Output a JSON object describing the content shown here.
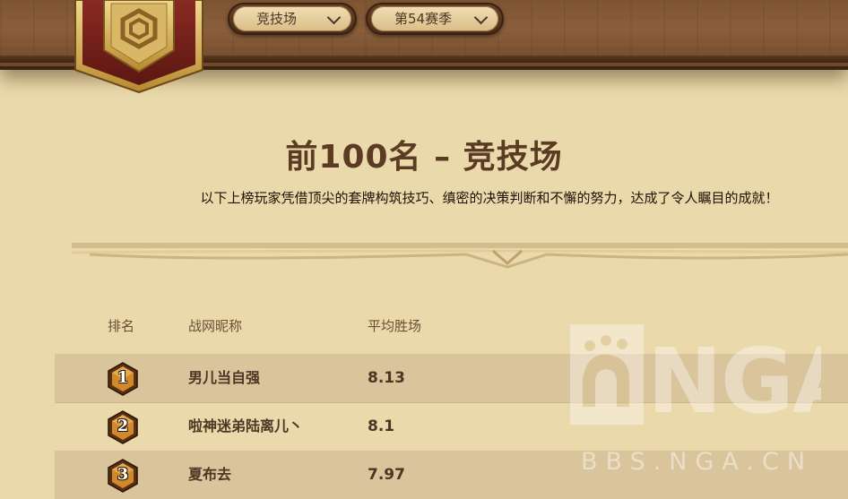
{
  "header": {
    "mode_select": {
      "value": "竞技场"
    },
    "season_select": {
      "value": "第54赛季"
    }
  },
  "title": "前100名 – 竞技场",
  "subtitle": "以下上榜玩家凭借顶尖的套牌构筑技巧、缜密的决策判断和不懈的努力，达成了令人瞩目的成就！",
  "table": {
    "columns": [
      "排名",
      "战网昵称",
      "平均胜场"
    ],
    "rows": [
      {
        "rank": "1",
        "name": "男儿当自强",
        "avg_wins": "8.13"
      },
      {
        "rank": "2",
        "name": "啦神迷弟陆离儿丶",
        "avg_wins": "8.1"
      },
      {
        "rank": "3",
        "name": "夏布去",
        "avg_wins": "7.97"
      }
    ]
  },
  "watermark": {
    "logo_text": "NGA",
    "url": "BBS.NGA.CN"
  },
  "icons": {
    "crest": "arena-crest-icon",
    "dropdown": "chevron-down-icon",
    "rank": "rank-hexagon-badge-icon"
  },
  "colors": {
    "background": "#ead9aa",
    "wood": "#7e5533",
    "text_dark": "#4e3524",
    "row_alt": "#d9c49b"
  }
}
